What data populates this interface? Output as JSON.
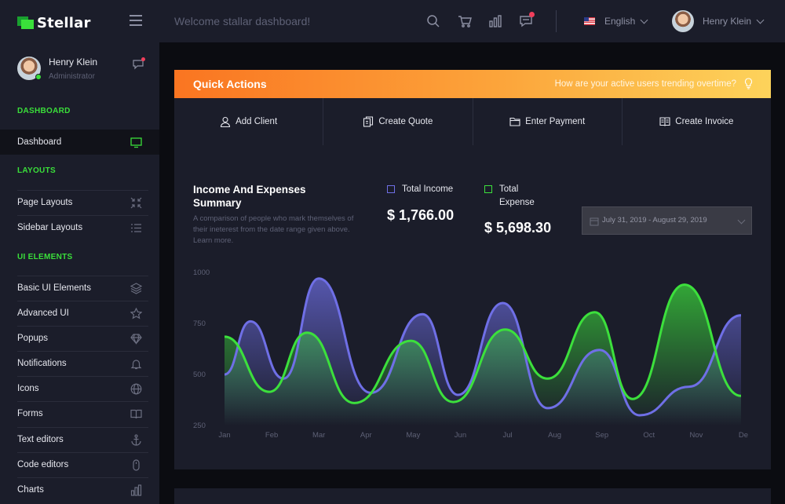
{
  "brand": {
    "name": "Stellar"
  },
  "header": {
    "welcome": "Welcome stallar dashboard!",
    "language": "English",
    "user_name": "Henry Klein"
  },
  "sidebar": {
    "profile": {
      "name": "Henry Klein",
      "role": "Administrator"
    },
    "sections": {
      "dashboard": "DASHBOARD",
      "layouts": "LAYOUTS",
      "ui_elements": "UI ELEMENTS"
    },
    "items": [
      {
        "label": "Dashboard",
        "icon": "monitor-icon"
      },
      {
        "label": "Page Layouts",
        "icon": "compress-icon"
      },
      {
        "label": "Sidebar Layouts",
        "icon": "list-icon"
      },
      {
        "label": "Basic UI Elements",
        "icon": "layers-icon"
      },
      {
        "label": "Advanced UI",
        "icon": "star-icon"
      },
      {
        "label": "Popups",
        "icon": "diamond-icon"
      },
      {
        "label": "Notifications",
        "icon": "bell-icon"
      },
      {
        "label": "Icons",
        "icon": "globe-icon"
      },
      {
        "label": "Forms",
        "icon": "book-icon"
      },
      {
        "label": "Text editors",
        "icon": "anchor-icon"
      },
      {
        "label": "Code editors",
        "icon": "mouse-icon"
      },
      {
        "label": "Charts",
        "icon": "bar-chart-icon"
      }
    ]
  },
  "quick_actions": {
    "title": "Quick Actions",
    "subtitle": "How are your active users trending overtime?",
    "buttons": [
      {
        "label": "Add Client",
        "icon": "user-icon"
      },
      {
        "label": "Create Quote",
        "icon": "documents-icon"
      },
      {
        "label": "Enter Payment",
        "icon": "folder-icon"
      },
      {
        "label": "Create Invoice",
        "icon": "book-open-icon"
      }
    ]
  },
  "income_card": {
    "title": "Income And Expenses Summary",
    "description": "A comparison of people who mark themselves of their ineterest from the date range given above. Learn more.",
    "income_label": "Total Income",
    "income_value": "$ 1,766.00",
    "expense_label": "Total Expense",
    "expense_value": "$ 5,698.30",
    "date_range": "July 31, 2019 - August 29, 2019"
  },
  "colors": {
    "accent_green": "#3adf3a",
    "income_purple": "#6f6fe6",
    "expense_green": "#3ce03c",
    "orange_start": "#fa7521",
    "orange_end": "#fdd35b"
  },
  "chart_data": {
    "type": "area",
    "categories": [
      "Jan",
      "Feb",
      "Mar",
      "Apr",
      "May",
      "Jun",
      "Jul",
      "Aug",
      "Sep",
      "Oct",
      "Nov",
      "De"
    ],
    "yticks": [
      1000,
      750,
      500,
      250
    ],
    "ylim": [
      250,
      1000
    ],
    "grid": false,
    "series": [
      {
        "name": "Total Income",
        "color": "#6f6fe6",
        "x": [
          0,
          0.55,
          1.25,
          2.0,
          3.1,
          4.2,
          4.95,
          5.9,
          6.85,
          7.95,
          8.8,
          9.85,
          10.95
        ],
        "values": [
          500,
          760,
          480,
          970,
          410,
          795,
          400,
          850,
          335,
          620,
          300,
          440,
          790
        ]
      },
      {
        "name": "Total Expense",
        "color": "#3ce03c",
        "x": [
          0,
          0.95,
          1.75,
          2.75,
          3.95,
          4.85,
          5.95,
          6.85,
          7.85,
          8.65,
          9.75,
          10.95
        ],
        "values": [
          685,
          415,
          705,
          360,
          665,
          365,
          720,
          480,
          805,
          380,
          940,
          395
        ]
      }
    ]
  }
}
